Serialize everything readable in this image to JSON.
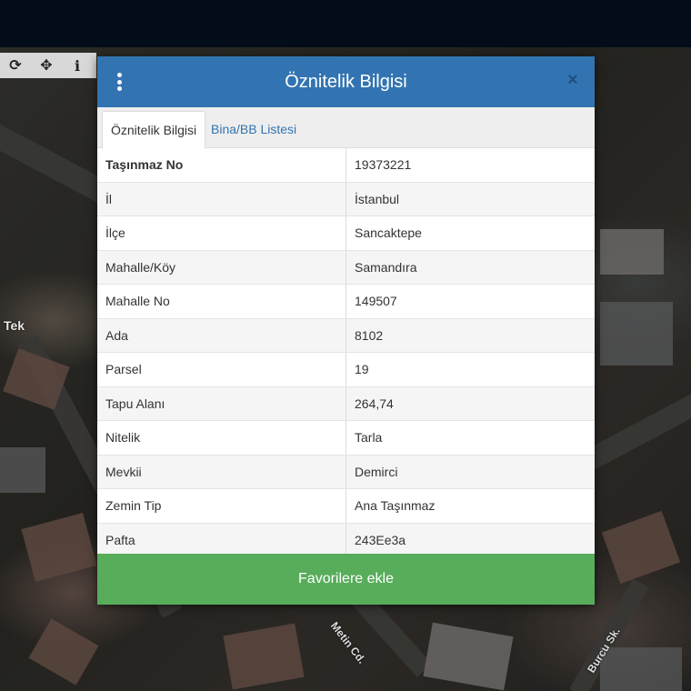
{
  "map": {
    "toolbar": {
      "refresh_icon": "⟳",
      "crosshair_icon": "✥",
      "info_icon": "i"
    },
    "labels": {
      "place": "Tek",
      "street1": "Metin Cd.",
      "street2": "Burcu Sk."
    }
  },
  "dialog": {
    "title": "Öznitelik Bilgisi",
    "close_icon": "×",
    "tabs": [
      {
        "label": "Öznitelik Bilgisi",
        "active": true
      },
      {
        "label": "Bina/BB Listesi",
        "active": false
      }
    ],
    "rows": [
      {
        "key": "Taşınmaz No",
        "value": "19373221"
      },
      {
        "key": "İl",
        "value": "İstanbul"
      },
      {
        "key": "İlçe",
        "value": "Sancaktepe"
      },
      {
        "key": "Mahalle/Köy",
        "value": "Samandıra"
      },
      {
        "key": "Mahalle No",
        "value": "149507"
      },
      {
        "key": "Ada",
        "value": "8102"
      },
      {
        "key": "Parsel",
        "value": "19"
      },
      {
        "key": "Tapu Alanı",
        "value": "264,74"
      },
      {
        "key": "Nitelik",
        "value": "Tarla"
      },
      {
        "key": "Mevkii",
        "value": "Demirci"
      },
      {
        "key": "Zemin Tip",
        "value": "Ana Taşınmaz"
      },
      {
        "key": "Pafta",
        "value": "243Ee3a"
      }
    ],
    "footer_button": "Favorilere ekle"
  },
  "colors": {
    "header": "#3274b1",
    "tab_link": "#3274b1",
    "footer": "#58ad5b",
    "topbar": "#030d1a"
  }
}
